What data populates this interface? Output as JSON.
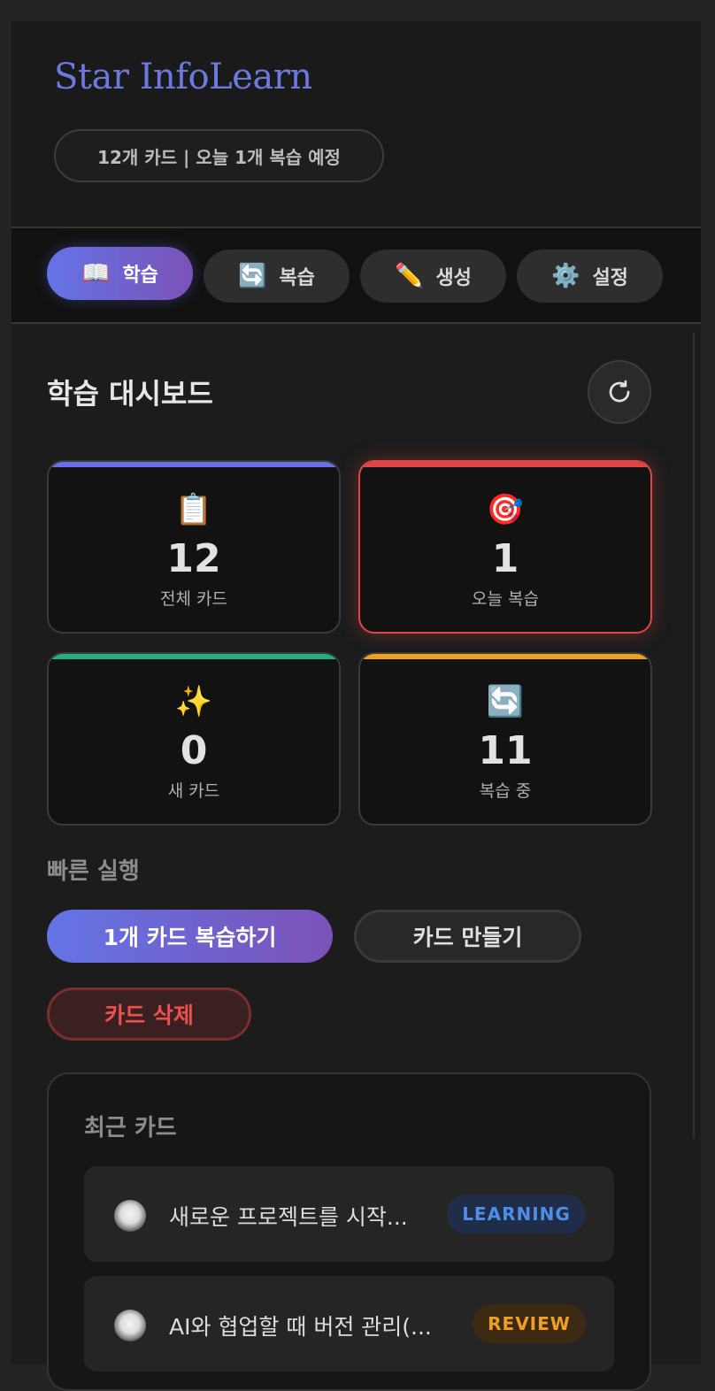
{
  "app": {
    "title": "Star InfoLearn",
    "summary": "12개 카드 | 오늘 1개 복습 예정"
  },
  "nav": {
    "tabs": [
      {
        "icon": "📖",
        "label": "학습",
        "active": true
      },
      {
        "icon": "🔄",
        "label": "복습",
        "active": false
      },
      {
        "icon": "✏️",
        "label": "생성",
        "active": false
      },
      {
        "icon": "⚙️",
        "label": "설정",
        "active": false
      }
    ]
  },
  "dashboard": {
    "title": "학습 대시보드",
    "refresh_icon": "refresh-icon",
    "stats": [
      {
        "icon": "📋",
        "value": "12",
        "label": "전체 카드",
        "accent": "#6b70e8"
      },
      {
        "icon": "🎯",
        "value": "1",
        "label": "오늘 복습",
        "accent": "#e04646"
      },
      {
        "icon": "✨",
        "value": "0",
        "label": "새 카드",
        "accent": "#22b07d"
      },
      {
        "icon": "🔄",
        "value": "11",
        "label": "복습 중",
        "accent": "#f0a020"
      }
    ]
  },
  "quick_actions": {
    "title": "빠른 실행",
    "review_label": "1개 카드 복습하기",
    "create_label": "카드 만들기",
    "delete_label": "카드 삭제"
  },
  "recent": {
    "title": "최근 카드",
    "cards": [
      {
        "text": "새로운 프로젝트를 시작...",
        "status": "LEARNING"
      },
      {
        "text": "AI와 협업할 때 버전 관리(...",
        "status": "REVIEW"
      }
    ]
  },
  "colors": {
    "accent": "#6474e6",
    "danger": "#ee5050",
    "learning": "#4f8de8",
    "review": "#f0a020"
  }
}
